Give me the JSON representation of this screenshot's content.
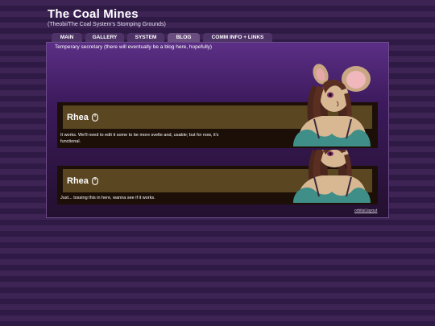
{
  "header": {
    "title": "The Coal Mines",
    "subtitle": "(Theobi/The Coal System's Stomping Grounds)"
  },
  "nav": {
    "tabs": [
      {
        "label": "MAIN",
        "active": false
      },
      {
        "label": "GALLERY",
        "active": false
      },
      {
        "label": "SYSTEM",
        "active": false
      },
      {
        "label": "BLOG",
        "active": true
      },
      {
        "label": "COMM INFO + LINKS",
        "active": false
      }
    ]
  },
  "main": {
    "intro": "Temperary secretary (there will eventually be a blog here, hopefully)",
    "posts": [
      {
        "author": "Rhea",
        "icon": "mouse-icon",
        "body": "It works. We'll need to edit it some to be more svelte and, usable; but for now, it's functional."
      },
      {
        "author": "Rhea",
        "icon": "mouse-icon",
        "body": "Just... tossing this in here, wanna see if it works."
      }
    ]
  },
  "footer": {
    "credit": "orbital.layout"
  },
  "colors": {
    "background": "#3a2152",
    "panel_accent": "#5b2f86",
    "post_header": "#5a4620",
    "character_dress": "#3f8f88",
    "character_hair": "#5a2f22"
  }
}
